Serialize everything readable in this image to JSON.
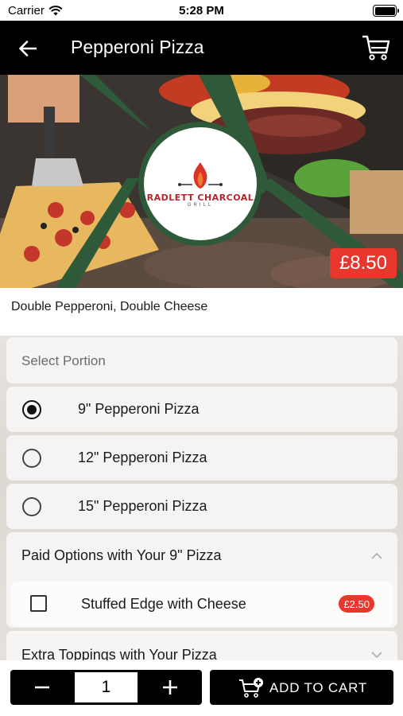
{
  "status_bar": {
    "carrier": "Carrier",
    "time": "5:28 PM"
  },
  "nav": {
    "title": "Pepperoni Pizza",
    "back_icon": "arrow-left-icon",
    "cart_icon": "shopping-cart-icon"
  },
  "hero": {
    "logo_text": "RADLETT CHARCOAL",
    "logo_sub": "GRILL",
    "price": "£8.50"
  },
  "description": "Double Pepperoni, Double Cheese",
  "portion": {
    "header": "Select Portion",
    "options": [
      {
        "label": "9\" Pepperoni Pizza",
        "selected": true
      },
      {
        "label": "12\" Pepperoni Pizza",
        "selected": false
      },
      {
        "label": "15\" Pepperoni Pizza",
        "selected": false
      }
    ]
  },
  "paid_options": {
    "title": "Paid Options with Your 9\" Pizza",
    "expanded": true,
    "items": [
      {
        "label": "Stuffed Edge with Cheese",
        "price": "£2.50",
        "checked": false
      }
    ]
  },
  "extra_toppings": {
    "title": "Extra Toppings with Your Pizza",
    "expanded": false
  },
  "bottom": {
    "quantity": "1",
    "minus_icon": "minus-icon",
    "plus_icon": "plus-icon",
    "add_to_cart": "ADD TO CART"
  },
  "colors": {
    "nav_bg": "#000000",
    "price_red": "#e8382e",
    "logo_green": "#2f5a3a",
    "logo_red": "#b8242a"
  }
}
